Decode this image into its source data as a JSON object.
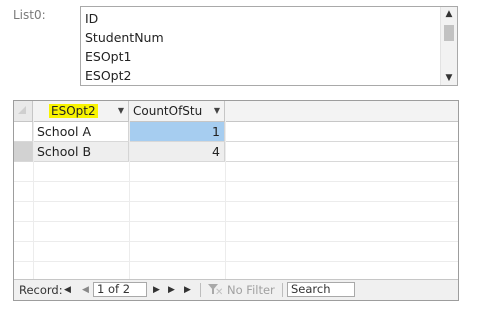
{
  "list": {
    "label": "List0:",
    "items": [
      "ID",
      "StudentNum",
      "ESOpt1",
      "ESOpt2"
    ]
  },
  "datasheet": {
    "columns": [
      "ESOpt2",
      "CountOfStu"
    ],
    "rows": [
      {
        "ESOpt2": "School A",
        "CountOfStu": "1"
      },
      {
        "ESOpt2": "School B",
        "CountOfStu": "4"
      }
    ]
  },
  "nav": {
    "record_label": "Record:",
    "position": "1 of 2",
    "filter_label": "No Filter",
    "search_label": "Search"
  },
  "colors": {
    "header_highlight": "#f8f400",
    "selected_cell": "#a6cdf0"
  }
}
